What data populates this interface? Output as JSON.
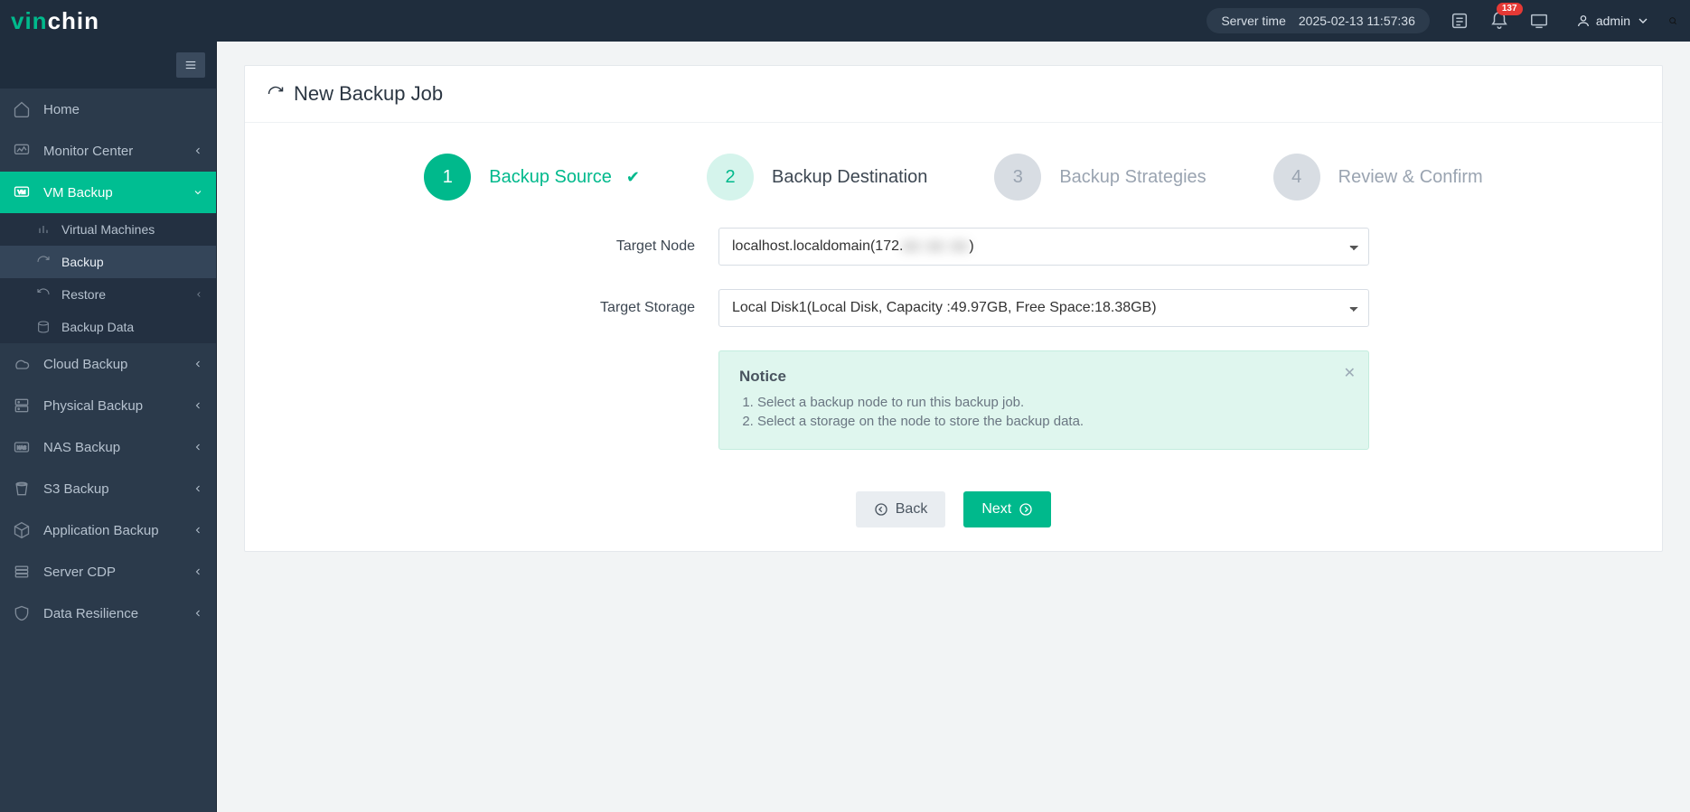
{
  "brand": {
    "part1": "vin",
    "part2": "chin"
  },
  "header": {
    "server_time_label": "Server time",
    "server_time_value": "2025-02-13 11:57:36",
    "badge_count": "137",
    "username": "admin"
  },
  "sidebar": {
    "items": [
      {
        "id": "home",
        "label": "Home",
        "icon": "home",
        "expandable": false
      },
      {
        "id": "monitor",
        "label": "Monitor Center",
        "icon": "monitor",
        "expandable": true
      },
      {
        "id": "vmbackup",
        "label": "VM Backup",
        "icon": "vm",
        "expandable": true,
        "active": true,
        "children": [
          {
            "id": "vms",
            "label": "Virtual Machines",
            "icon": "bars"
          },
          {
            "id": "backup",
            "label": "Backup",
            "icon": "refresh",
            "active": true
          },
          {
            "id": "restore",
            "label": "Restore",
            "icon": "undo",
            "expandable": true
          },
          {
            "id": "bdata",
            "label": "Backup Data",
            "icon": "db"
          }
        ]
      },
      {
        "id": "cloud",
        "label": "Cloud Backup",
        "icon": "cloud",
        "expandable": true
      },
      {
        "id": "physical",
        "label": "Physical Backup",
        "icon": "server",
        "expandable": true
      },
      {
        "id": "nas",
        "label": "NAS Backup",
        "icon": "nas",
        "expandable": true
      },
      {
        "id": "s3",
        "label": "S3 Backup",
        "icon": "bucket",
        "expandable": true
      },
      {
        "id": "app",
        "label": "Application Backup",
        "icon": "cube",
        "expandable": true
      },
      {
        "id": "cdp",
        "label": "Server CDP",
        "icon": "stack",
        "expandable": true
      },
      {
        "id": "resilience",
        "label": "Data Resilience",
        "icon": "shield",
        "expandable": true
      }
    ]
  },
  "page": {
    "title": "New Backup Job"
  },
  "steps": [
    {
      "num": "1",
      "label": "Backup Source",
      "state": "done",
      "check": true
    },
    {
      "num": "2",
      "label": "Backup Destination",
      "state": "current",
      "check": false
    },
    {
      "num": "3",
      "label": "Backup Strategies",
      "state": "idle",
      "check": false
    },
    {
      "num": "4",
      "label": "Review & Confirm",
      "state": "idle",
      "check": false
    }
  ],
  "form": {
    "target_node_label": "Target Node",
    "target_node_value": "localhost.localdomain(172.xx.xx.xx)",
    "target_node_display_prefix": "localhost.localdomain(172.",
    "target_node_display_redacted": "xx xx xx",
    "target_node_display_suffix": ")",
    "target_storage_label": "Target Storage",
    "target_storage_value": "Local Disk1(Local Disk, Capacity :49.97GB, Free Space:18.38GB)"
  },
  "notice": {
    "title": "Notice",
    "lines": [
      "Select a backup node to run this backup job.",
      "Select a storage on the node to store the backup data."
    ]
  },
  "buttons": {
    "back": "Back",
    "next": "Next"
  }
}
